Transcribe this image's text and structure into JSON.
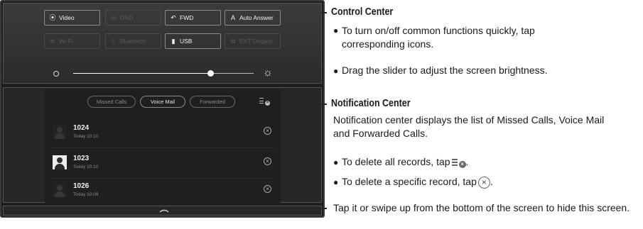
{
  "control_center": {
    "tiles": [
      {
        "icon": "location-pin-icon",
        "glyph": "⦿",
        "label": "Video",
        "enabled": true
      },
      {
        "icon": "dnd-icon",
        "glyph": "⊖",
        "label": "DND",
        "enabled": false
      },
      {
        "icon": "forward-arrow-icon",
        "glyph": "↶",
        "label": "FWD",
        "enabled": true
      },
      {
        "icon": "auto-answer-icon",
        "glyph": "A",
        "label": "Auto Answer",
        "enabled": true
      },
      {
        "icon": "wifi-icon",
        "glyph": "≋",
        "label": "Wi-Fi",
        "enabled": false
      },
      {
        "icon": "bluetooth-icon",
        "glyph": "ᛒ",
        "label": "Bluetooth",
        "enabled": false
      },
      {
        "icon": "usb-icon",
        "glyph": "▮",
        "label": "USB",
        "enabled": true
      },
      {
        "icon": "ext-display-icon",
        "glyph": "⧉",
        "label": "EXT Display",
        "enabled": false
      }
    ],
    "brightness": 0.76
  },
  "notification_center": {
    "tabs": [
      "Missed Calls",
      "Voice Mail",
      "Forwarded"
    ],
    "selected_tab": "Voice Mail",
    "records": [
      {
        "number": "1024",
        "time": "Today 10:10",
        "highlighted": false
      },
      {
        "number": "1023",
        "time": "Today 10:10",
        "highlighted": true
      },
      {
        "number": "1026",
        "time": "Today 10:09",
        "highlighted": false
      }
    ]
  },
  "annotations": {
    "control_title": "Control Center",
    "control_bullet1": "To turn on/off common functions quickly, tap corresponding icons.",
    "control_bullet2": "Drag the slider to adjust the screen brightness.",
    "notif_title": "Notification Center",
    "notif_desc": "Notification center displays the list of Missed Calls, Voice Mail and Forwarded Calls.",
    "notif_bullet1_prefix": "To delete all records, tap",
    "notif_bullet1_suffix": ".",
    "notif_bullet2_prefix": "To delete a specific record, tap",
    "notif_bullet2_suffix": ".",
    "hide_text": "Tap it or swipe up from the bottom of the screen to hide this screen."
  }
}
